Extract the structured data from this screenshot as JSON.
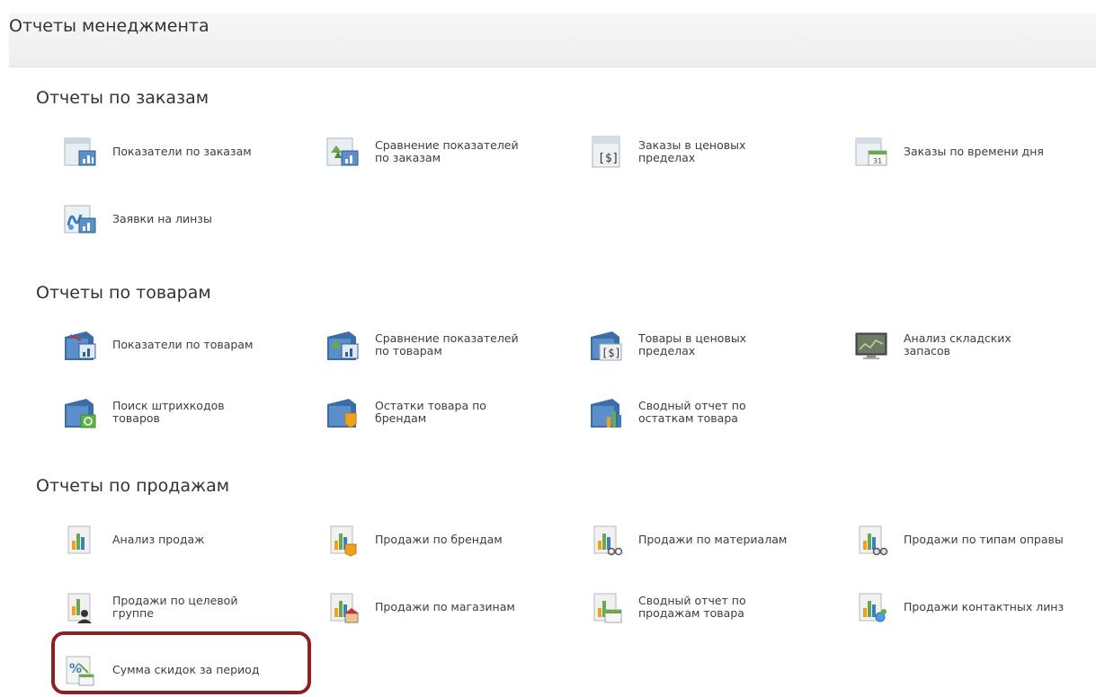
{
  "page_title": "Отчеты менеджмента",
  "sections": [
    {
      "title": "Отчеты по заказам",
      "items": [
        {
          "label": "Показатели по заказам",
          "icon": "order-report-icon"
        },
        {
          "label": "Сравнение показателей\nпо заказам",
          "icon": "order-compare-icon"
        },
        {
          "label": "Заказы в ценовых\nпределах",
          "icon": "order-price-range-icon"
        },
        {
          "label": "Заказы по времени дня",
          "icon": "order-time-icon"
        },
        {
          "label": "Заявки на линзы",
          "icon": "lens-request-icon"
        }
      ]
    },
    {
      "title": "Отчеты по товарам",
      "items": [
        {
          "label": "Показатели по товарам",
          "icon": "product-report-icon"
        },
        {
          "label": "Сравнение показателей\nпо товарам",
          "icon": "product-compare-icon"
        },
        {
          "label": "Товары в ценовых\nпределах",
          "icon": "product-price-range-icon"
        },
        {
          "label": "Анализ складских\nзапасов",
          "icon": "stock-analysis-icon"
        },
        {
          "label": "Поиск штрихкодов\nтоваров",
          "icon": "barcode-search-icon"
        },
        {
          "label": "Остатки товара по\nбрендам",
          "icon": "brand-stock-icon"
        },
        {
          "label": "Сводный отчет по\nостаткам товара",
          "icon": "stock-summary-icon"
        }
      ]
    },
    {
      "title": "Отчеты по продажам",
      "items": [
        {
          "label": "Анализ продаж",
          "icon": "sales-analysis-icon"
        },
        {
          "label": "Продажи по брендам",
          "icon": "sales-brand-icon"
        },
        {
          "label": "Продажи по материалам",
          "icon": "sales-material-icon"
        },
        {
          "label": "Продажи по типам оправы",
          "icon": "sales-frame-type-icon"
        },
        {
          "label": "Продажи по целевой\nгруппе",
          "icon": "sales-target-group-icon"
        },
        {
          "label": "Продажи по магазинам",
          "icon": "sales-store-icon"
        },
        {
          "label": "Сводный отчет по\nпродажам товара",
          "icon": "sales-summary-icon"
        },
        {
          "label": "Продажи контактных линз",
          "icon": "sales-contact-lens-icon"
        },
        {
          "label": "Сумма скидок за период",
          "icon": "discount-sum-icon"
        }
      ]
    }
  ]
}
